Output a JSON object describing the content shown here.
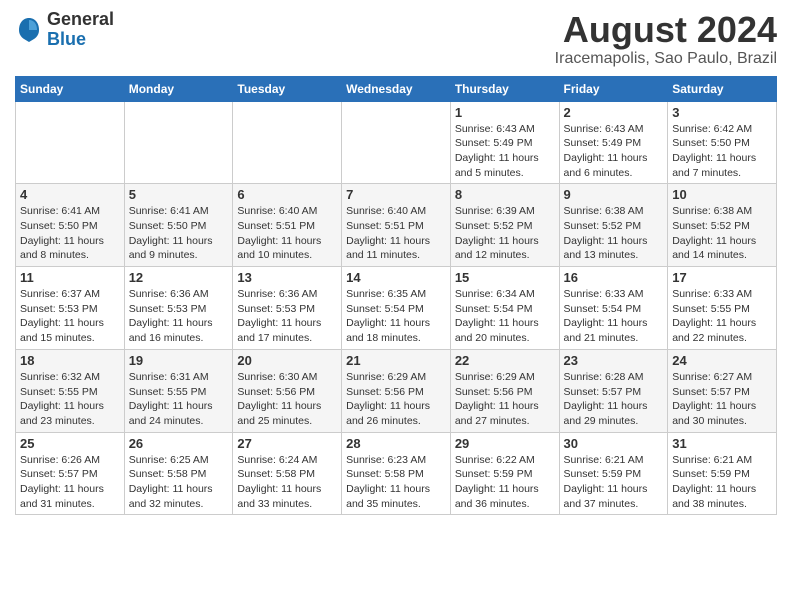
{
  "header": {
    "logo_line1": "General",
    "logo_line2": "Blue",
    "month_title": "August 2024",
    "location": "Iracemapolis, Sao Paulo, Brazil"
  },
  "weekdays": [
    "Sunday",
    "Monday",
    "Tuesday",
    "Wednesday",
    "Thursday",
    "Friday",
    "Saturday"
  ],
  "weeks": [
    [
      {
        "day": "",
        "info": ""
      },
      {
        "day": "",
        "info": ""
      },
      {
        "day": "",
        "info": ""
      },
      {
        "day": "",
        "info": ""
      },
      {
        "day": "1",
        "info": "Sunrise: 6:43 AM\nSunset: 5:49 PM\nDaylight: 11 hours\nand 5 minutes."
      },
      {
        "day": "2",
        "info": "Sunrise: 6:43 AM\nSunset: 5:49 PM\nDaylight: 11 hours\nand 6 minutes."
      },
      {
        "day": "3",
        "info": "Sunrise: 6:42 AM\nSunset: 5:50 PM\nDaylight: 11 hours\nand 7 minutes."
      }
    ],
    [
      {
        "day": "4",
        "info": "Sunrise: 6:41 AM\nSunset: 5:50 PM\nDaylight: 11 hours\nand 8 minutes."
      },
      {
        "day": "5",
        "info": "Sunrise: 6:41 AM\nSunset: 5:50 PM\nDaylight: 11 hours\nand 9 minutes."
      },
      {
        "day": "6",
        "info": "Sunrise: 6:40 AM\nSunset: 5:51 PM\nDaylight: 11 hours\nand 10 minutes."
      },
      {
        "day": "7",
        "info": "Sunrise: 6:40 AM\nSunset: 5:51 PM\nDaylight: 11 hours\nand 11 minutes."
      },
      {
        "day": "8",
        "info": "Sunrise: 6:39 AM\nSunset: 5:52 PM\nDaylight: 11 hours\nand 12 minutes."
      },
      {
        "day": "9",
        "info": "Sunrise: 6:38 AM\nSunset: 5:52 PM\nDaylight: 11 hours\nand 13 minutes."
      },
      {
        "day": "10",
        "info": "Sunrise: 6:38 AM\nSunset: 5:52 PM\nDaylight: 11 hours\nand 14 minutes."
      }
    ],
    [
      {
        "day": "11",
        "info": "Sunrise: 6:37 AM\nSunset: 5:53 PM\nDaylight: 11 hours\nand 15 minutes."
      },
      {
        "day": "12",
        "info": "Sunrise: 6:36 AM\nSunset: 5:53 PM\nDaylight: 11 hours\nand 16 minutes."
      },
      {
        "day": "13",
        "info": "Sunrise: 6:36 AM\nSunset: 5:53 PM\nDaylight: 11 hours\nand 17 minutes."
      },
      {
        "day": "14",
        "info": "Sunrise: 6:35 AM\nSunset: 5:54 PM\nDaylight: 11 hours\nand 18 minutes."
      },
      {
        "day": "15",
        "info": "Sunrise: 6:34 AM\nSunset: 5:54 PM\nDaylight: 11 hours\nand 20 minutes."
      },
      {
        "day": "16",
        "info": "Sunrise: 6:33 AM\nSunset: 5:54 PM\nDaylight: 11 hours\nand 21 minutes."
      },
      {
        "day": "17",
        "info": "Sunrise: 6:33 AM\nSunset: 5:55 PM\nDaylight: 11 hours\nand 22 minutes."
      }
    ],
    [
      {
        "day": "18",
        "info": "Sunrise: 6:32 AM\nSunset: 5:55 PM\nDaylight: 11 hours\nand 23 minutes."
      },
      {
        "day": "19",
        "info": "Sunrise: 6:31 AM\nSunset: 5:55 PM\nDaylight: 11 hours\nand 24 minutes."
      },
      {
        "day": "20",
        "info": "Sunrise: 6:30 AM\nSunset: 5:56 PM\nDaylight: 11 hours\nand 25 minutes."
      },
      {
        "day": "21",
        "info": "Sunrise: 6:29 AM\nSunset: 5:56 PM\nDaylight: 11 hours\nand 26 minutes."
      },
      {
        "day": "22",
        "info": "Sunrise: 6:29 AM\nSunset: 5:56 PM\nDaylight: 11 hours\nand 27 minutes."
      },
      {
        "day": "23",
        "info": "Sunrise: 6:28 AM\nSunset: 5:57 PM\nDaylight: 11 hours\nand 29 minutes."
      },
      {
        "day": "24",
        "info": "Sunrise: 6:27 AM\nSunset: 5:57 PM\nDaylight: 11 hours\nand 30 minutes."
      }
    ],
    [
      {
        "day": "25",
        "info": "Sunrise: 6:26 AM\nSunset: 5:57 PM\nDaylight: 11 hours\nand 31 minutes."
      },
      {
        "day": "26",
        "info": "Sunrise: 6:25 AM\nSunset: 5:58 PM\nDaylight: 11 hours\nand 32 minutes."
      },
      {
        "day": "27",
        "info": "Sunrise: 6:24 AM\nSunset: 5:58 PM\nDaylight: 11 hours\nand 33 minutes."
      },
      {
        "day": "28",
        "info": "Sunrise: 6:23 AM\nSunset: 5:58 PM\nDaylight: 11 hours\nand 35 minutes."
      },
      {
        "day": "29",
        "info": "Sunrise: 6:22 AM\nSunset: 5:59 PM\nDaylight: 11 hours\nand 36 minutes."
      },
      {
        "day": "30",
        "info": "Sunrise: 6:21 AM\nSunset: 5:59 PM\nDaylight: 11 hours\nand 37 minutes."
      },
      {
        "day": "31",
        "info": "Sunrise: 6:21 AM\nSunset: 5:59 PM\nDaylight: 11 hours\nand 38 minutes."
      }
    ]
  ]
}
